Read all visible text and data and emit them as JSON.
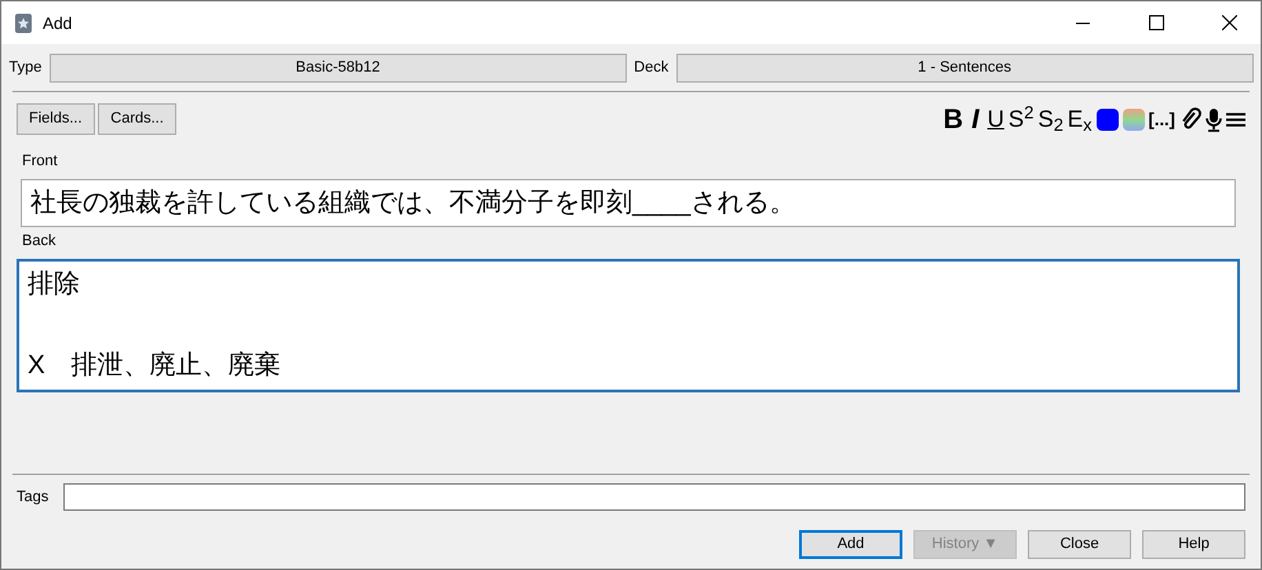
{
  "window": {
    "title": "Add"
  },
  "type": {
    "label": "Type",
    "value": "Basic-58b12"
  },
  "deck": {
    "label": "Deck",
    "value": "1 - Sentences"
  },
  "left_buttons": [
    "Fields...",
    "Cards..."
  ],
  "toolbar": [
    {
      "kind": "bold",
      "text": "B"
    },
    {
      "kind": "italic",
      "text": "I"
    },
    {
      "kind": "underline",
      "text": "U"
    },
    {
      "kind": "super",
      "text": "S",
      "sub": "2"
    },
    {
      "kind": "sub",
      "text": "S",
      "sub": "2"
    },
    {
      "kind": "sub",
      "text": "E",
      "sub": "x"
    },
    {
      "kind": "swatch",
      "color": "#0000ff"
    },
    {
      "kind": "gradient"
    },
    {
      "kind": "plain",
      "text": "[...]"
    },
    {
      "kind": "clip"
    },
    {
      "kind": "mic"
    },
    {
      "kind": "menu"
    }
  ],
  "fields": [
    {
      "label": "Front",
      "focused": false,
      "paragraphs": [
        "社長の独裁を許している組織では、不満分子を即刻____される。"
      ]
    },
    {
      "label": "Back",
      "focused": true,
      "paragraphs": [
        "排除",
        "X　排泄、廃止、廃棄"
      ]
    }
  ],
  "tags": {
    "label": "Tags"
  },
  "buttons": [
    {
      "label": "Add",
      "default": true,
      "disabled": false
    },
    {
      "label": "History ▼",
      "default": false,
      "disabled": true
    },
    {
      "label": "Close",
      "default": false,
      "disabled": false
    },
    {
      "label": "Help",
      "default": false,
      "disabled": false
    }
  ]
}
